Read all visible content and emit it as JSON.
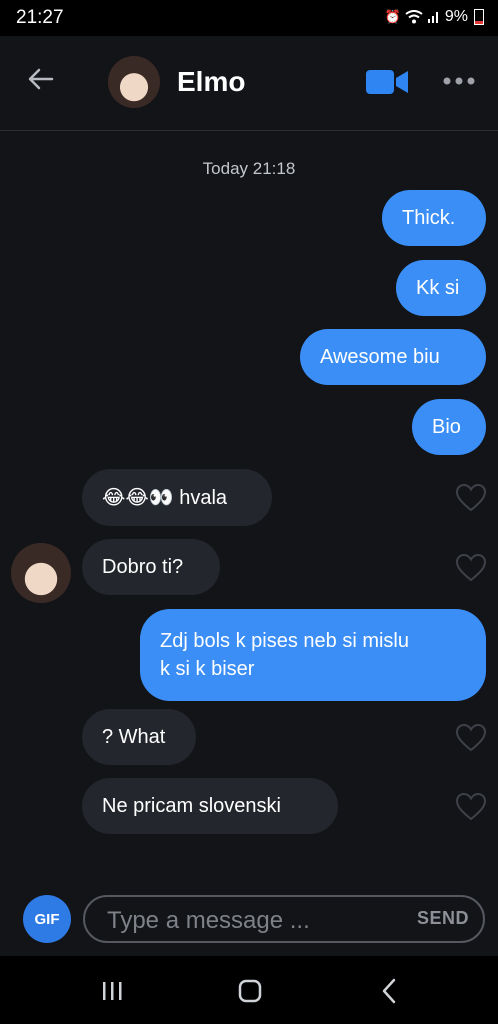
{
  "status_bar": {
    "time": "21:27",
    "battery": "9%"
  },
  "header": {
    "contact_name": "Elmo"
  },
  "chat": {
    "date_separator": "Today 21:18",
    "messages": [
      {
        "direction": "out",
        "text": "Thick."
      },
      {
        "direction": "out",
        "text": "Kk si"
      },
      {
        "direction": "out",
        "text": "Awesome biu"
      },
      {
        "direction": "out",
        "text": "Bio"
      },
      {
        "direction": "in",
        "emojis": "😂😂👀",
        "text": "hvala"
      },
      {
        "direction": "in",
        "text": "Dobro ti?"
      },
      {
        "direction": "out",
        "line1": "Zdj bols k pises neb si mislu",
        "line2": "k si k biser"
      },
      {
        "direction": "in",
        "text": "? What"
      },
      {
        "direction": "in",
        "text": "Ne pricam slovenski"
      }
    ]
  },
  "composer": {
    "gif_label": "GIF",
    "placeholder": "Type a message ...",
    "value": "",
    "send_label": "SEND"
  },
  "colors": {
    "outgoing_bubble": "#3a8ef6",
    "incoming_bubble": "#23262c",
    "background": "#121418",
    "accent": "#2f7be6"
  },
  "icons": [
    "back-arrow-icon",
    "video-call-icon",
    "more-options-icon",
    "heart-icon",
    "recent-apps-icon",
    "home-icon",
    "nav-back-icon"
  ]
}
